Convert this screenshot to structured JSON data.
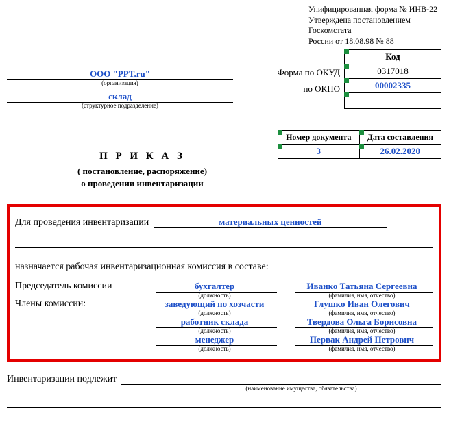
{
  "form_info": {
    "line1": "Унифицированная форма № ИНВ-22",
    "line2": "Утверждена постановлением Госкомстата",
    "line3": "России от 18.08.98 № 88"
  },
  "org": {
    "name": "ООО \"PPT.ru\"",
    "caption": "(организация)"
  },
  "dept": {
    "name": "склад",
    "caption": "(структурное подразделение)"
  },
  "codes": {
    "header": "Код",
    "rows": [
      {
        "label": "Форма по ОКУД",
        "value": "0317018"
      },
      {
        "label": "по ОКПО",
        "value": "00002335"
      },
      {
        "label": "",
        "value": ""
      }
    ]
  },
  "order": {
    "title": "П Р И К А З",
    "sub1": "( постановление, распоряжение)",
    "sub2": "о проведении инвентаризации"
  },
  "doc": {
    "num_header": "Номер документа",
    "date_header": "Дата составления",
    "number": "3",
    "date": "26.02.2020"
  },
  "body": {
    "intro_label": "Для проведения инвентаризации",
    "intro_value": "материальных ценностей",
    "assign": "назначается рабочая инвентаризационная комиссия в составе:",
    "chair_label": "Председатель комиссии",
    "members_label": "Члены комиссии:",
    "role_caption": "(должность)",
    "name_caption": "(фамилия, имя, отчество)",
    "rows": [
      {
        "role": "бухгалтер",
        "name": "Иванко Татьяна Сергеевна"
      },
      {
        "role": "заведующий по хозчасти",
        "name": "Глушко Иван Олегович"
      },
      {
        "role": "работник склада",
        "name": "Твердова Ольга Борисовна"
      },
      {
        "role": "менеджер",
        "name": "Первак Андрей Петрович"
      }
    ]
  },
  "subject": {
    "label": "Инвентаризации подлежит",
    "caption": "(наименование имущества, обязательства)"
  }
}
